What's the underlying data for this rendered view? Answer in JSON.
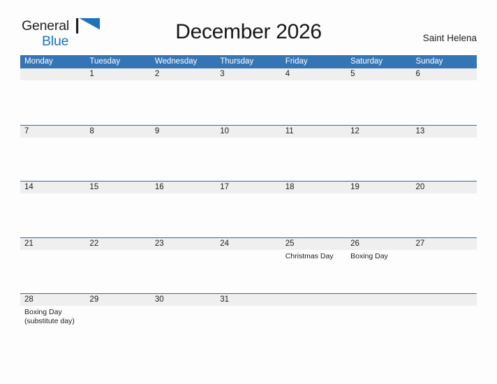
{
  "brand": {
    "name_part_1": "General",
    "name_part_2": "Blue",
    "flag_icon": "blue-flag-triangle",
    "flag_color": "#1c72bd"
  },
  "header": {
    "title": "December 2026",
    "region": "Saint Helena"
  },
  "theme": {
    "header_blue": "#3575b5",
    "row_rule_blue": "#2f6ca5",
    "daynum_band": "#efefef",
    "page_background": "#fdfdfd",
    "text": "#1d1d1d"
  },
  "calendar": {
    "month": "December",
    "year": "2026",
    "weekday_headers": [
      "Monday",
      "Tuesday",
      "Wednesday",
      "Thursday",
      "Friday",
      "Saturday",
      "Sunday"
    ],
    "weeks": [
      [
        {
          "day": "",
          "events": []
        },
        {
          "day": "1",
          "events": []
        },
        {
          "day": "2",
          "events": []
        },
        {
          "day": "3",
          "events": []
        },
        {
          "day": "4",
          "events": []
        },
        {
          "day": "5",
          "events": []
        },
        {
          "day": "6",
          "events": []
        }
      ],
      [
        {
          "day": "7",
          "events": []
        },
        {
          "day": "8",
          "events": []
        },
        {
          "day": "9",
          "events": []
        },
        {
          "day": "10",
          "events": []
        },
        {
          "day": "11",
          "events": []
        },
        {
          "day": "12",
          "events": []
        },
        {
          "day": "13",
          "events": []
        }
      ],
      [
        {
          "day": "14",
          "events": []
        },
        {
          "day": "15",
          "events": []
        },
        {
          "day": "16",
          "events": []
        },
        {
          "day": "17",
          "events": []
        },
        {
          "day": "18",
          "events": []
        },
        {
          "day": "19",
          "events": []
        },
        {
          "day": "20",
          "events": []
        }
      ],
      [
        {
          "day": "21",
          "events": []
        },
        {
          "day": "22",
          "events": []
        },
        {
          "day": "23",
          "events": []
        },
        {
          "day": "24",
          "events": []
        },
        {
          "day": "25",
          "events": [
            "Christmas Day"
          ]
        },
        {
          "day": "26",
          "events": [
            "Boxing Day"
          ]
        },
        {
          "day": "27",
          "events": []
        }
      ],
      [
        {
          "day": "28",
          "events": [
            "Boxing Day",
            "(substitute day)"
          ]
        },
        {
          "day": "29",
          "events": []
        },
        {
          "day": "30",
          "events": []
        },
        {
          "day": "31",
          "events": []
        },
        {
          "day": "",
          "events": []
        },
        {
          "day": "",
          "events": []
        },
        {
          "day": "",
          "events": []
        }
      ]
    ]
  }
}
